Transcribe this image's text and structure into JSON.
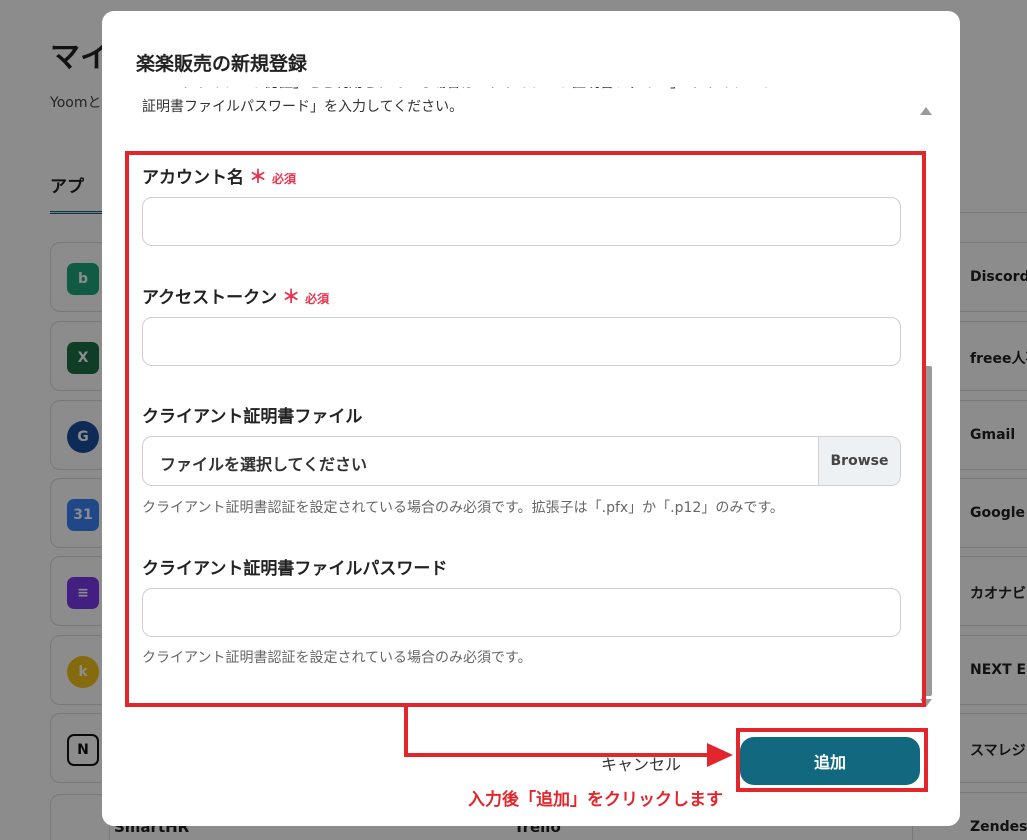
{
  "background": {
    "title": "マイ",
    "subtitle": "Yoomと",
    "tab": "アプ",
    "right_apps": [
      "Discord",
      "freee人事",
      "Gmail",
      "Google",
      "カオナビ",
      "NEXT EN",
      "スマレジ",
      "Zendesk"
    ],
    "bottom_apps": [
      "SmartHR",
      "Trello"
    ]
  },
  "modal": {
    "title": "楽楽販売の新規登録",
    "intro_line_1": "「SSLクライアント認証」をご利用されている場合は「クライアント証明書ファイル」「クライアント",
    "intro_line_2": "証明書ファイルパスワード」を入力してください。",
    "required_mark": "＊",
    "required_text": "必須",
    "fields": {
      "account_name": {
        "label": "アカウント名",
        "value": ""
      },
      "access_token": {
        "label": "アクセストークン",
        "value": ""
      },
      "client_cert_file": {
        "label": "クライアント証明書ファイル",
        "placeholder": "ファイルを選択してください",
        "browse": "Browse",
        "help": "クライアント証明書認証を設定されている場合のみ必須です。拡張子は「.pfx」か「.p12」のみです。"
      },
      "client_cert_password": {
        "label": "クライアント証明書ファイルパスワード",
        "value": "",
        "help": "クライアント証明書認証を設定されている場合のみ必須です。"
      }
    },
    "buttons": {
      "cancel": "キャンセル",
      "add": "追加"
    }
  },
  "annotation": "入力後「追加」をクリックします"
}
